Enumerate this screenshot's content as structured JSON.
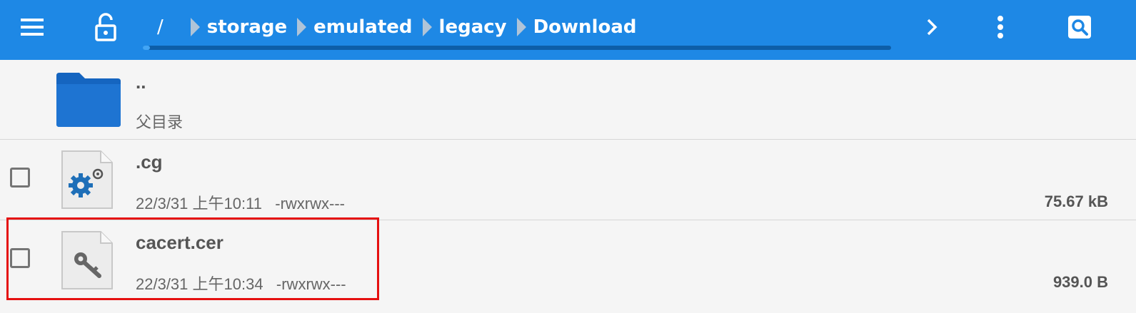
{
  "toolbar": {
    "menu_icon": "hamburger-menu-icon",
    "lock_icon": "unlocked-padlock-icon",
    "breadcrumb": {
      "root": "/",
      "items": [
        "storage",
        "emulated",
        "legacy",
        "Download"
      ]
    },
    "forward_icon": "chevron-right-icon",
    "more_icon": "more-vert-icon",
    "search_icon": "search-icon",
    "colors": {
      "background": "#1e88e5",
      "progress_track": "#0d5ea8"
    }
  },
  "files": [
    {
      "name": "..",
      "meta": "父目录",
      "size": "",
      "icon": "folder-icon",
      "has_checkbox": false
    },
    {
      "name": ".cg",
      "meta": "22/3/31 上午10:11   -rwxrwx---",
      "size": "75.67 kB",
      "icon": "settings-file-icon",
      "has_checkbox": true
    },
    {
      "name": "cacert.cer",
      "meta": "22/3/31 上午10:34   -rwxrwx---",
      "size": "939.0 B",
      "icon": "certificate-key-file-icon",
      "has_checkbox": true,
      "highlighted": true
    }
  ],
  "highlight_color": "#e51010"
}
